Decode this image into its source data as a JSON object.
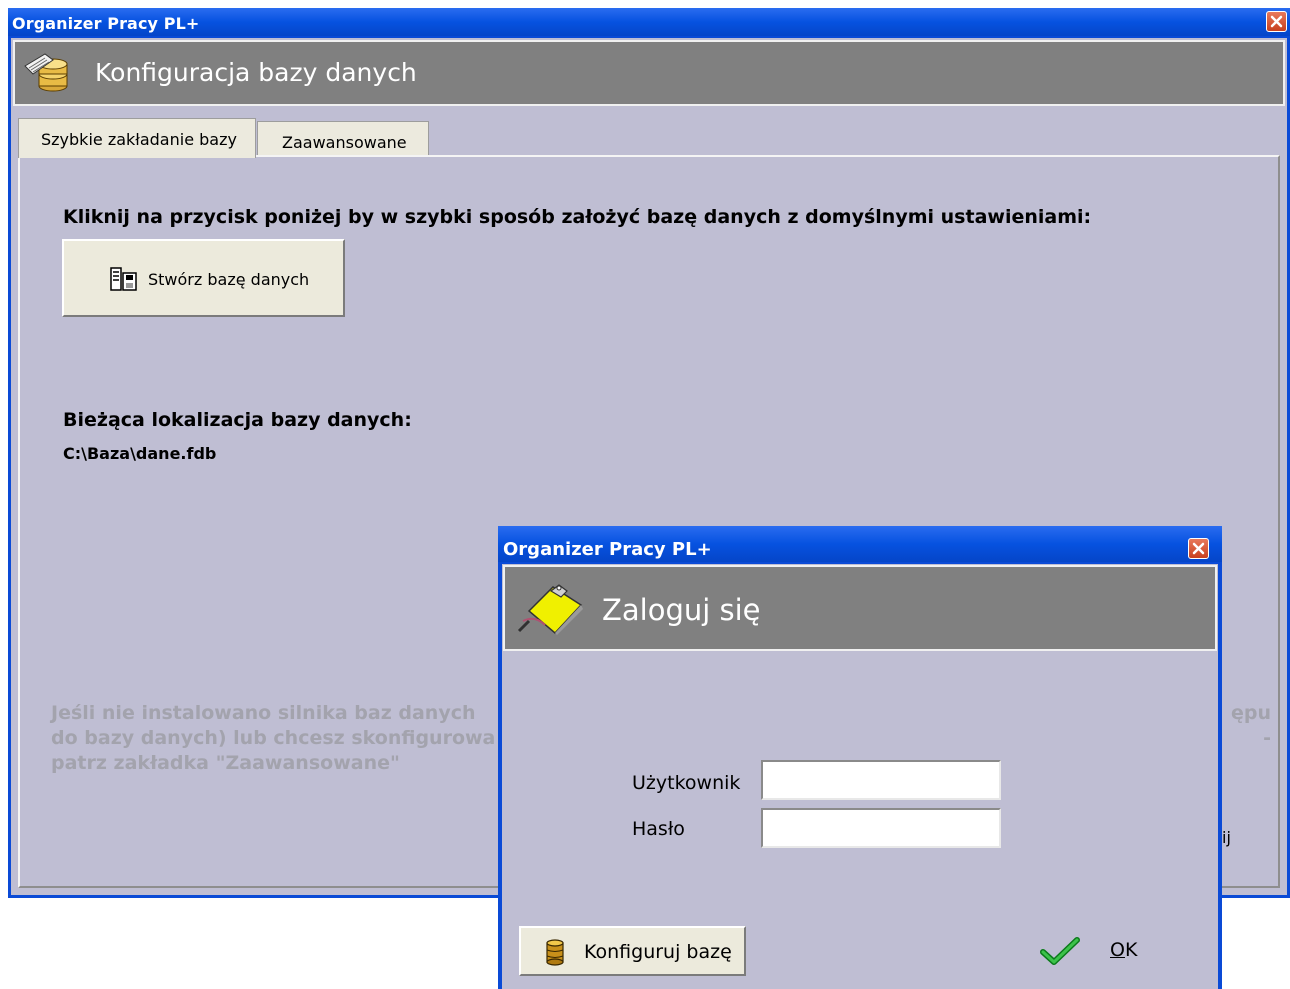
{
  "main_window": {
    "title": "Organizer Pracy PL+",
    "header_title": "Konfiguracja bazy danych",
    "tabs": [
      {
        "label": "Szybkie zakładanie bazy",
        "active": true
      },
      {
        "label": "Zaawansowane",
        "active": false
      }
    ],
    "instruction": "Kliknij na przycisk poniżej by w szybki sposób założyć bazę danych z domyślnymi ustawieniami:",
    "create_button_label": "Stwórz bazę danych",
    "current_location_label": "Bieżąca lokalizacja bazy danych:",
    "current_location_value": "C:\\Baza\\dane.fdb",
    "hint_lines": [
      "Jeśli nie instalowano silnika baz danych",
      "do bazy danych) lub chcesz skonfigurowa",
      "patrz zakładka \"Zaawansowane\""
    ],
    "hint_right_lines": [
      "ępu",
      "-"
    ],
    "stray_text": "ij"
  },
  "login_dialog": {
    "title": "Organizer Pracy PL+",
    "header_title": "Zaloguj się",
    "user_label": "Użytkownik",
    "user_value": "",
    "password_label": "Hasło",
    "password_value": "",
    "configure_button_label": "Konfiguruj bazę",
    "ok_button_label": "OK"
  },
  "colors": {
    "titlebar": "#0652e0",
    "client_bg": "#bfbed3",
    "header_bg": "#808080",
    "button_face": "#eceadc",
    "hint_text": "#a3a3ad"
  }
}
